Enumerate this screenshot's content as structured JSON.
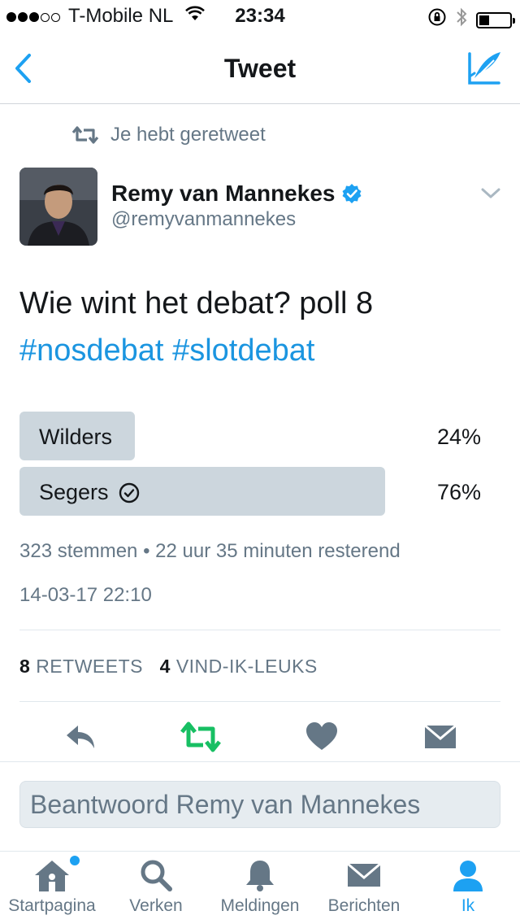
{
  "status_bar": {
    "carrier": "T-Mobile NL",
    "time": "23:34",
    "signal_bars": 3,
    "battery_level": 0.25
  },
  "nav": {
    "title": "Tweet",
    "back_icon": "chevron-left-icon",
    "compose_icon": "compose-feather-icon"
  },
  "retweet_context": "Je hebt geretweet",
  "tweet": {
    "author_name": "Remy van Mannekes",
    "author_handle": "@remyvanmannekes",
    "verified": true,
    "text": "Wie wint het debat? poll 8",
    "hashtags": [
      "#nosdebat",
      "#slotdebat"
    ],
    "poll": {
      "options": [
        {
          "label": "Wilders",
          "percent": "24%",
          "value": 0.24,
          "selected": false
        },
        {
          "label": "Segers",
          "percent": "76%",
          "value": 0.76,
          "selected": true
        }
      ],
      "meta": "323 stemmen • 22 uur 35 minuten resterend"
    },
    "timestamp": "14-03-17 22:10",
    "retweets_count": "8",
    "retweets_label": "RETWEETS",
    "likes_count": "4",
    "likes_label": "VIND-IK-LEUKS"
  },
  "actions": {
    "reply_icon": "reply-icon",
    "retweet_icon": "retweet-icon",
    "like_icon": "heart-icon",
    "dm_icon": "envelope-icon",
    "retweet_active_color": "#17bf63"
  },
  "reply_box": {
    "placeholder": "Beantwoord Remy van Mannekes"
  },
  "tab_bar": {
    "tabs": [
      {
        "label": "Startpagina",
        "icon": "home-icon"
      },
      {
        "label": "Verken",
        "icon": "search-icon"
      },
      {
        "label": "Meldingen",
        "icon": "bell-icon"
      },
      {
        "label": "Berichten",
        "icon": "envelope-icon"
      },
      {
        "label": "Ik",
        "icon": "person-icon"
      }
    ],
    "active_index": 4
  },
  "colors": {
    "accent": "#1da1f2",
    "hashtag": "#1b95e0",
    "muted_text": "#657786",
    "poll_bar": "#ccd6dd",
    "verified_badge": "#1da1f2"
  }
}
